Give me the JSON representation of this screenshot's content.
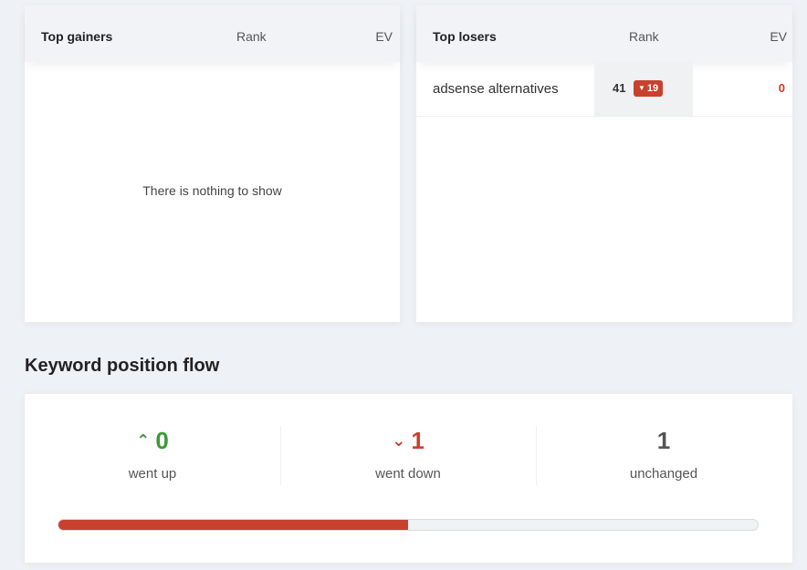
{
  "top_gainers": {
    "title": "Top gainers",
    "rank_header": "Rank",
    "ev_header": "EV",
    "empty_message": "There is nothing to show"
  },
  "top_losers": {
    "title": "Top losers",
    "rank_header": "Rank",
    "ev_header": "EV",
    "rows": [
      {
        "keyword": "adsense alternatives",
        "rank": "41",
        "change": "19",
        "ev": "0"
      }
    ]
  },
  "flow": {
    "title": "Keyword position flow",
    "went_up": {
      "value": "0",
      "label": "went up"
    },
    "went_down": {
      "value": "1",
      "label": "went down"
    },
    "unchanged": {
      "value": "1",
      "label": "unchanged"
    },
    "progress_fraction": 0.5
  },
  "colors": {
    "accent_down": "#c8412f",
    "accent_up": "#3a9a35"
  },
  "icons": {
    "up": "chevron-up-icon",
    "down": "chevron-down-icon",
    "badge": "triangle-down-icon"
  }
}
